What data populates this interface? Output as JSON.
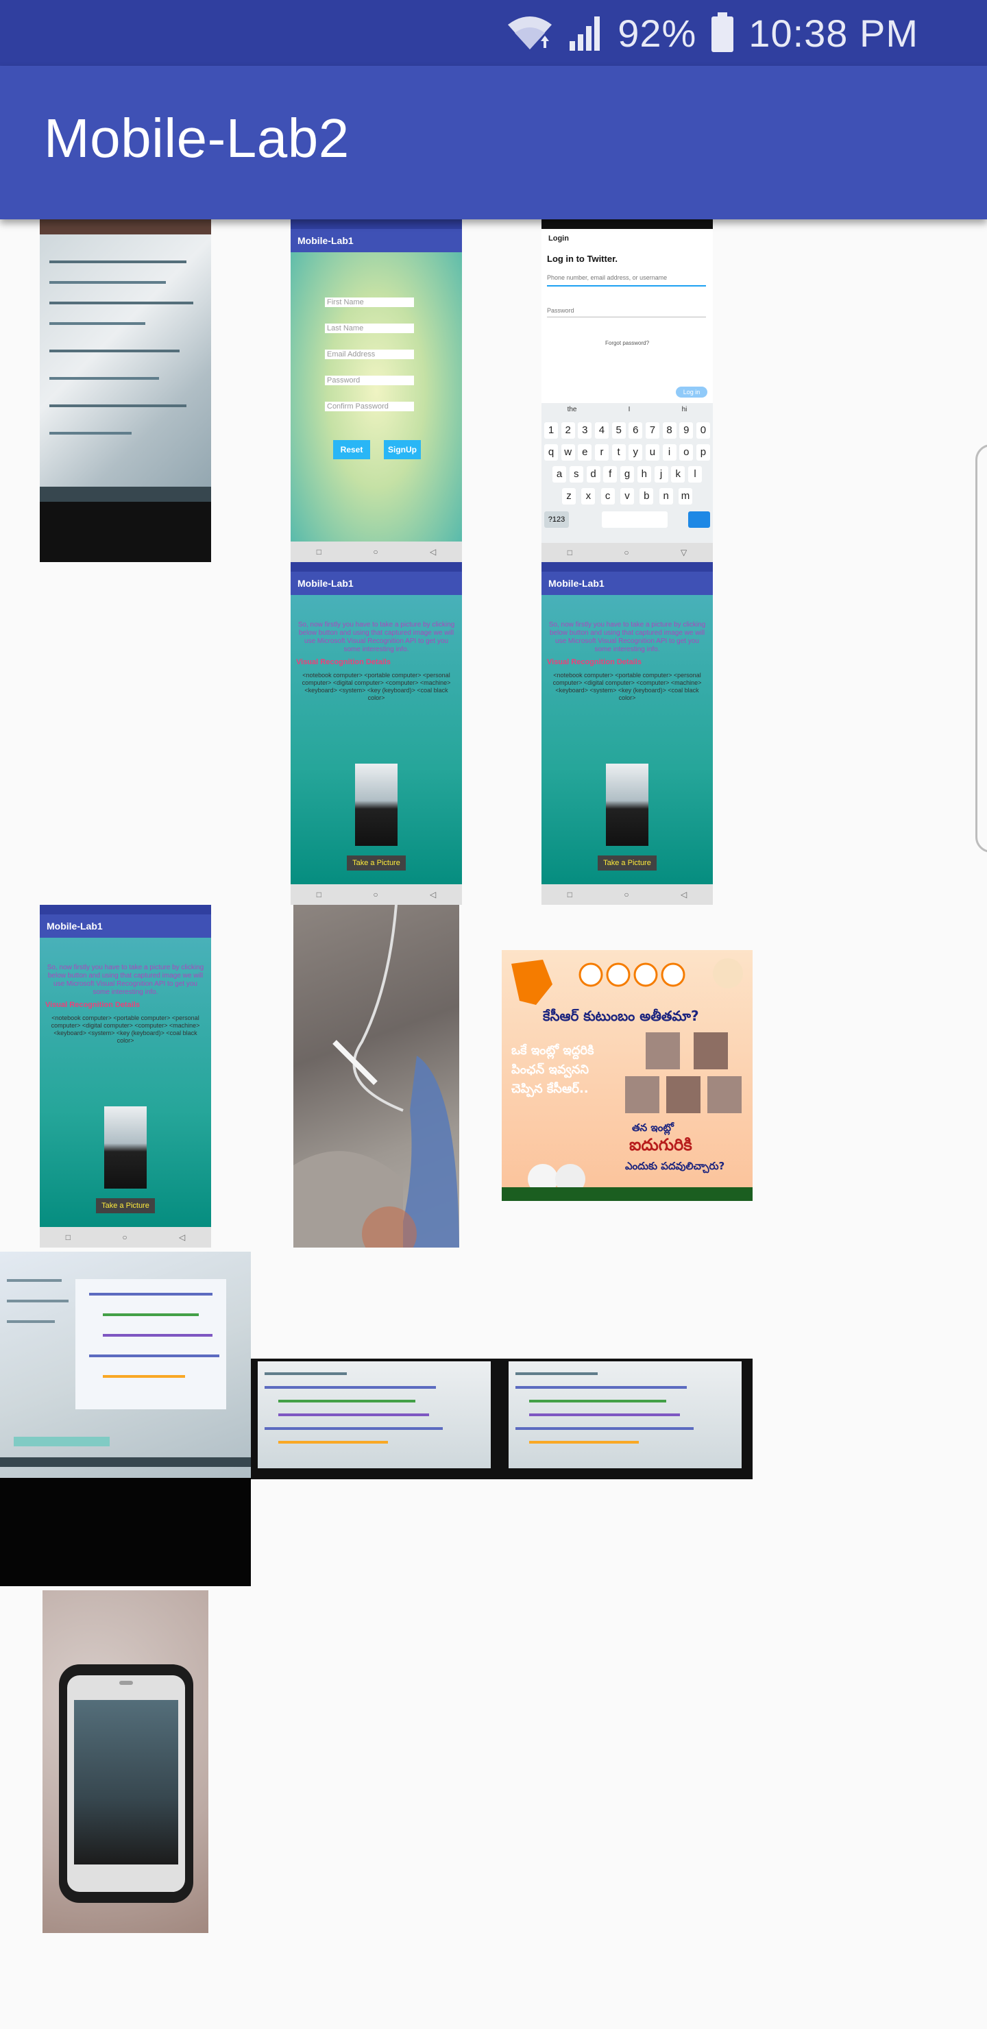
{
  "status_bar": {
    "battery_percent": "92%",
    "time": "10:38 PM",
    "icons": [
      "wifi-icon",
      "signal-icon",
      "battery-icon"
    ]
  },
  "app_bar": {
    "title": "Mobile-Lab2"
  },
  "colors": {
    "status_bar": "#303F9F",
    "app_bar": "#3F51B5",
    "background": "#FAFAFA"
  },
  "gallery": {
    "signup_screenshot": {
      "app_title": "Mobile-Lab1",
      "fields": [
        "First Name",
        "Last Name",
        "Email Address",
        "Password",
        "Confirm Password"
      ],
      "reset_label": "Reset",
      "signup_label": "SignUp"
    },
    "twitter_screenshot": {
      "header": "Login",
      "heading": "Log in to Twitter.",
      "username_placeholder": "Phone number, email address, or username",
      "password_placeholder": "Password",
      "forgot_label": "Forgot password?",
      "login_label": "Log in",
      "suggestions": [
        "the",
        "I",
        "hi"
      ],
      "number_row": [
        "1",
        "2",
        "3",
        "4",
        "5",
        "6",
        "7",
        "8",
        "9",
        "0"
      ],
      "row1": [
        "q",
        "w",
        "e",
        "r",
        "t",
        "y",
        "u",
        "i",
        "o",
        "p"
      ],
      "row2": [
        "a",
        "s",
        "d",
        "f",
        "g",
        "h",
        "j",
        "k",
        "l"
      ],
      "row3": [
        "z",
        "x",
        "c",
        "v",
        "b",
        "n",
        "m"
      ],
      "symbols_label": "?123"
    },
    "vision_screenshot": {
      "app_title": "Mobile-Lab1",
      "intro": "So, now firstly you have to take a picture by clicking below button and using that captured image we will use Microsoft Visual Recognition API to get you some interesting info.",
      "details_title": "Visual Recognition Details",
      "details": "<notebook computer> <portable computer> <personal computer> <digital computer> <computer> <machine> <keyboard> <system> <key (keyboard)> <coal black color>",
      "take_picture_label": "Take a Picture"
    },
    "poster": {
      "headline": "కేసీఆర్ కుటుంబం అతీతమా?",
      "line1": "ఒకే ఇంట్లో ఇద్దరికి",
      "line2": "పింఛన్ ఇవ్వనని",
      "line3": "చెప్పిన కేసీఆర్..",
      "line4": "తన ఇంట్లో",
      "line5": "ఐదుగురికి",
      "line6": "ఎందుకు పదవులిచ్చారు?"
    }
  }
}
